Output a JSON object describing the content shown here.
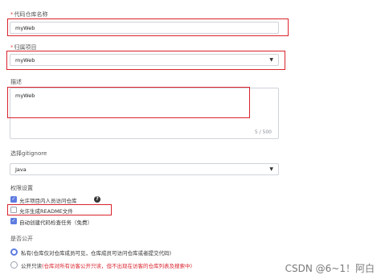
{
  "repo_name": {
    "label": "代码仓库名称",
    "required": "*",
    "value": "myWeb"
  },
  "project": {
    "label": "归属项目",
    "required": "*",
    "value": "myWeb"
  },
  "description": {
    "label": "描述",
    "value": "myWeb",
    "counter": "5 / 500"
  },
  "gitignore": {
    "label": "选择gitignore",
    "value": "Java"
  },
  "permissions": {
    "label": "权限设置",
    "options": [
      {
        "label": "允许项目内人员访问仓库",
        "checked": true
      },
      {
        "label": "允许生成README文件",
        "checked": false
      },
      {
        "label": "自动创建代码检查任务（免费）",
        "checked": true
      }
    ]
  },
  "visibility": {
    "label": "是否公开",
    "private_label": "私有",
    "private_desc": "(仓库仅对仓库成员可见，仓库成员可访问仓库或者提交代码)",
    "public_label": "公开只读",
    "public_desc": "(仓库对所有访客公开只读，但不出现在访客的仓库列表及搜索中)"
  },
  "watermark": "CSDN @6~1！阿白",
  "colors": {
    "accent": "#5e7ce0",
    "highlight": "#d9232d"
  }
}
